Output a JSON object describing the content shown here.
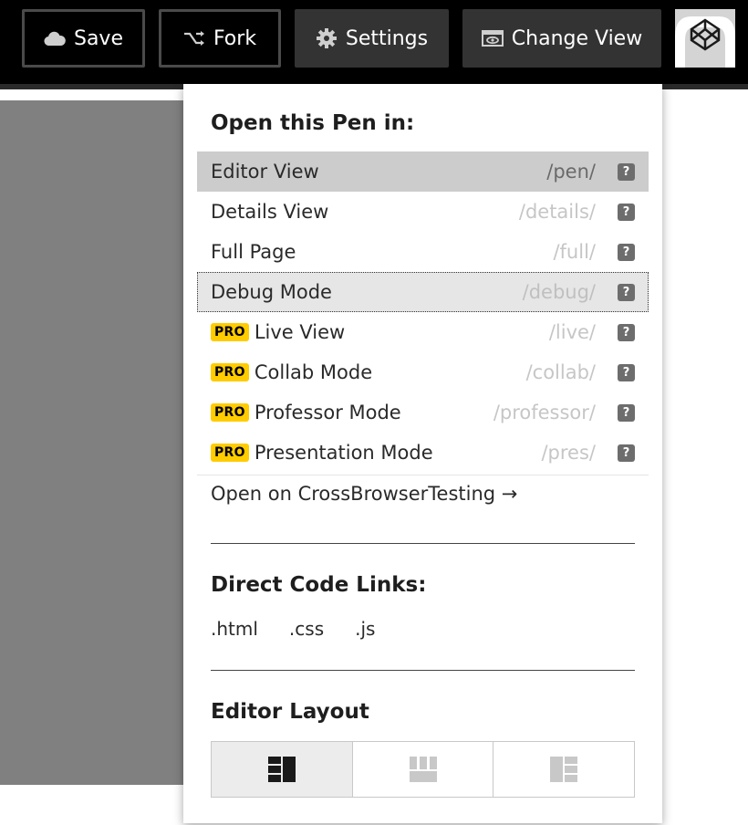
{
  "toolbar": {
    "save_label": "Save",
    "fork_label": "Fork",
    "settings_label": "Settings",
    "change_view_label": "Change View"
  },
  "dropdown": {
    "open_heading": "Open this Pen in:",
    "views": [
      {
        "name": "Editor View",
        "path": "/pen/",
        "pro": false,
        "state": "active"
      },
      {
        "name": "Details View",
        "path": "/details/",
        "pro": false,
        "state": "normal"
      },
      {
        "name": "Full Page",
        "path": "/full/",
        "pro": false,
        "state": "normal"
      },
      {
        "name": "Debug Mode",
        "path": "/debug/",
        "pro": false,
        "state": "hover"
      },
      {
        "name": "Live View",
        "path": "/live/",
        "pro": true,
        "state": "normal"
      },
      {
        "name": "Collab Mode",
        "path": "/collab/",
        "pro": true,
        "state": "normal"
      },
      {
        "name": "Professor Mode",
        "path": "/professor/",
        "pro": true,
        "state": "normal"
      },
      {
        "name": "Presentation Mode",
        "path": "/pres/",
        "pro": true,
        "state": "normal"
      }
    ],
    "help_glyph": "?",
    "pro_badge": "PRO",
    "cross_browser_link": "Open on CrossBrowserTesting →",
    "code_heading": "Direct Code Links:",
    "code_links": [
      ".html",
      ".css",
      ".js"
    ],
    "layout_heading": "Editor Layout",
    "layout_options": [
      "left-layout-icon",
      "top-layout-icon",
      "right-layout-icon"
    ],
    "selected_layout": 0
  },
  "colors": {
    "topbar": "#000000",
    "pro_badge": "#ffcc00",
    "active_row": "#cccccc"
  }
}
